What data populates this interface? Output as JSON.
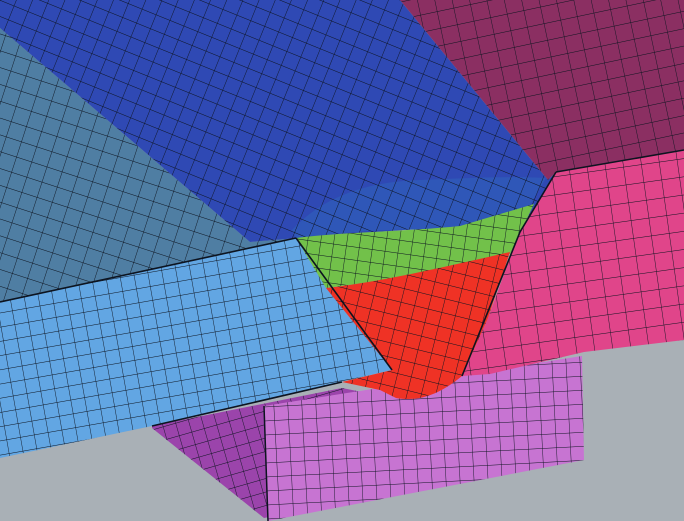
{
  "scene": {
    "description_visible_text": "",
    "colors": {
      "background": "#a9b0b6",
      "plate_left_top": "#4f7ea3",
      "plate_left_side": "#62a6e3",
      "plate_right_top": "#8b2f62",
      "plate_right_side": "#e0458a",
      "weld_cap": "#2f49b4",
      "weld_inner_cap": "#2f57b8",
      "weld_pass_green": "#72c14a",
      "weld_pass_red": "#ef3225",
      "backing_bar_top": "#9b44ab",
      "backing_bar_side": "#c774d2",
      "mesh_lines": "#0d1420"
    },
    "regions": [
      "left-plate-top",
      "left-plate-front",
      "right-plate-top",
      "right-plate-front",
      "weld-cap",
      "weld-root-pass",
      "weld-fill-pass",
      "backing-bar-top",
      "backing-bar-front"
    ]
  }
}
